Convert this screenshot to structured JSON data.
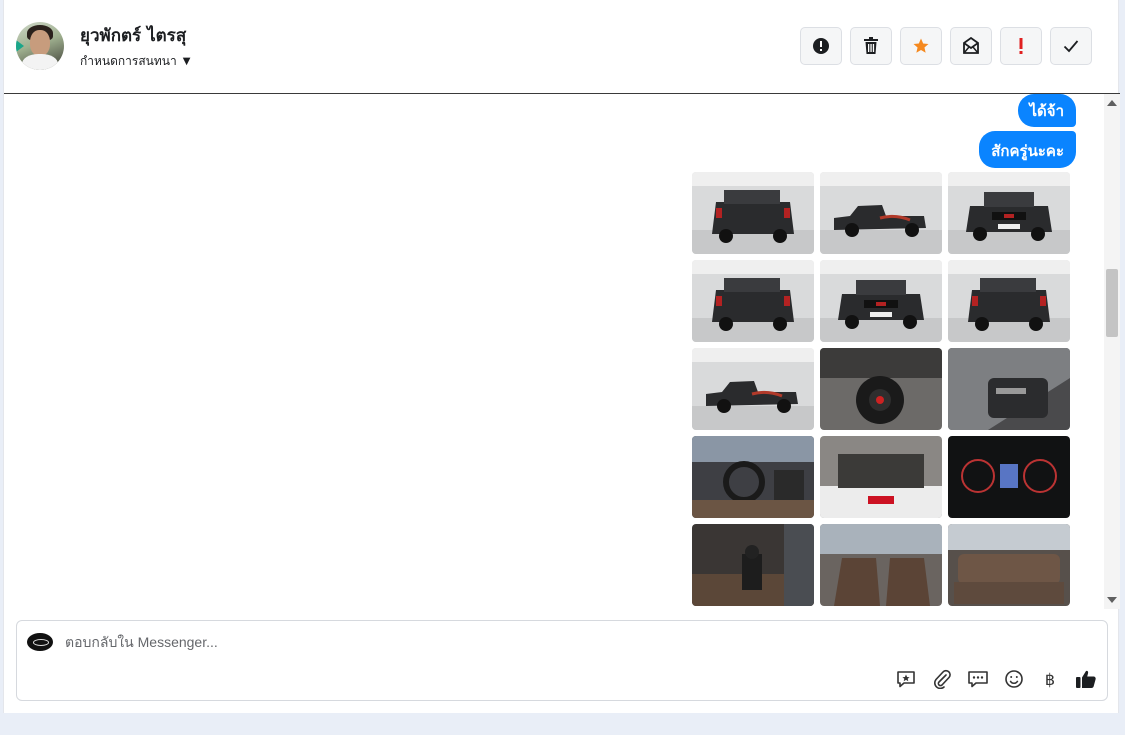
{
  "header": {
    "contact_name": "ยุวพักตร์ ไตรสุ",
    "assign_label": "กำหนดการสนทนา",
    "toolbar": [
      {
        "name": "mark-spam-button",
        "icon": "alert-circle-icon"
      },
      {
        "name": "delete-button",
        "icon": "trash-icon"
      },
      {
        "name": "star-button",
        "icon": "star-icon",
        "color": "#f5891f"
      },
      {
        "name": "mark-unread-button",
        "icon": "envelope-icon"
      },
      {
        "name": "priority-button",
        "icon": "exclamation-icon",
        "color": "#e02020"
      },
      {
        "name": "mark-done-button",
        "icon": "check-icon"
      }
    ]
  },
  "messages": [
    {
      "text": "ได้จ้า",
      "from": "page"
    },
    {
      "text": "สักครู่นะคะ",
      "from": "page"
    }
  ],
  "photos": [
    {
      "subject": "pickup-rear-three-quarter"
    },
    {
      "subject": "pickup-side-studio"
    },
    {
      "subject": "pickup-front-three-quarter"
    },
    {
      "subject": "pickup-rear-left"
    },
    {
      "subject": "pickup-front"
    },
    {
      "subject": "pickup-rear"
    },
    {
      "subject": "pickup-side-long"
    },
    {
      "subject": "wheel-closeup"
    },
    {
      "subject": "door-panel"
    },
    {
      "subject": "dashboard-interior"
    },
    {
      "subject": "engine-bay"
    },
    {
      "subject": "instrument-cluster"
    },
    {
      "subject": "gear-shifter"
    },
    {
      "subject": "front-seats"
    },
    {
      "subject": "rear-seats"
    }
  ],
  "composer": {
    "placeholder": "ตอบกลับใน Messenger...",
    "tools": [
      "saved-reply-icon",
      "attachment-icon",
      "quick-reply-icon",
      "emoji-icon",
      "baht-icon",
      "thumbs-up-icon"
    ],
    "baht_symbol": "฿"
  },
  "colors": {
    "accent": "#0a84ff",
    "star": "#f5891f",
    "priority": "#e02020"
  }
}
